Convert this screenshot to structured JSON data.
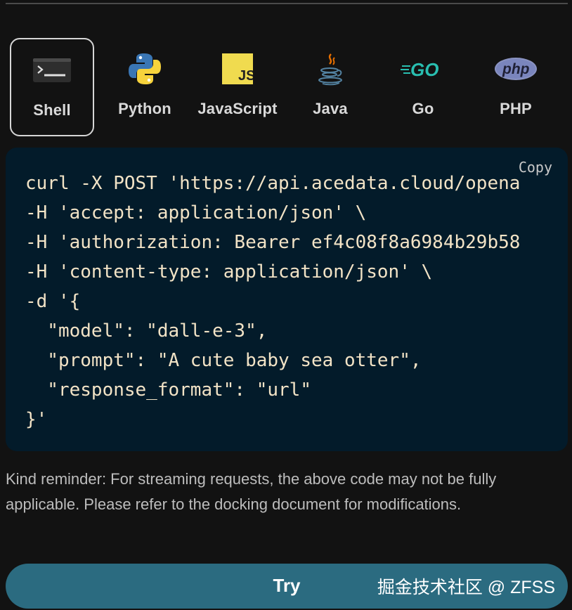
{
  "tabs": [
    {
      "label": "Shell",
      "icon": "terminal-icon",
      "active": true
    },
    {
      "label": "Python",
      "icon": "python-icon",
      "active": false
    },
    {
      "label": "JavaScript",
      "icon": "javascript-icon",
      "active": false
    },
    {
      "label": "Java",
      "icon": "java-icon",
      "active": false
    },
    {
      "label": "Go",
      "icon": "go-icon",
      "active": false
    },
    {
      "label": "PHP",
      "icon": "php-icon",
      "active": false
    }
  ],
  "icon_text": {
    "js": "JS",
    "go": "GO",
    "php": "php"
  },
  "code_panel": {
    "copy_label": "Copy",
    "lines": [
      "curl -X POST 'https://api.acedata.cloud/opena",
      "-H 'accept: application/json' \\",
      "-H 'authorization: Bearer ef4c08f8a6984b29b58",
      "-H 'content-type: application/json' \\",
      "-d '{",
      "  \"model\": \"dall-e-3\",",
      "  \"prompt\": \"A cute baby sea otter\",",
      "  \"response_format\": \"url\"",
      "}'"
    ]
  },
  "reminder": "Kind reminder: For streaming requests, the above code may not be fully applicable. Please refer to the docking document for modifications.",
  "try_button": {
    "label": "Try"
  },
  "watermark": "掘金技术社区 @ ZFSS",
  "colors": {
    "background": "#121212",
    "code_background": "#031b2a",
    "code_text": "#f2e3c6",
    "try_button": "#2b6b80",
    "active_tab_border": "#d6d6d6"
  }
}
